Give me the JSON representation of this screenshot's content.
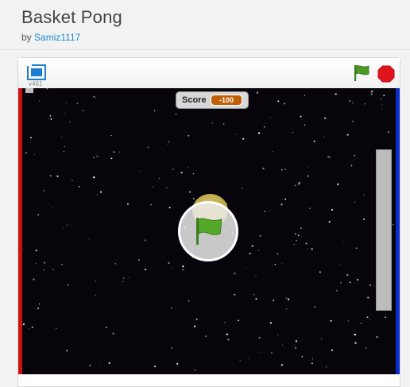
{
  "project": {
    "title": "Basket Pong",
    "by_label": "by",
    "author": "Samiz1117"
  },
  "player": {
    "version": "v461",
    "icons": {
      "fullscreen": "fullscreen-icon",
      "green_flag": "green-flag-icon",
      "stop": "stop-sign-icon"
    },
    "colors": {
      "green_flag": "#4c9a26",
      "stop": "#e0141b",
      "left_wall": "#cc1111",
      "right_wall": "#0a2cc7",
      "stage_background": "#07040b"
    }
  },
  "stage": {
    "monitor": {
      "label": "Score",
      "value": "-100"
    },
    "overlay_icon": "green-flag-icon"
  }
}
